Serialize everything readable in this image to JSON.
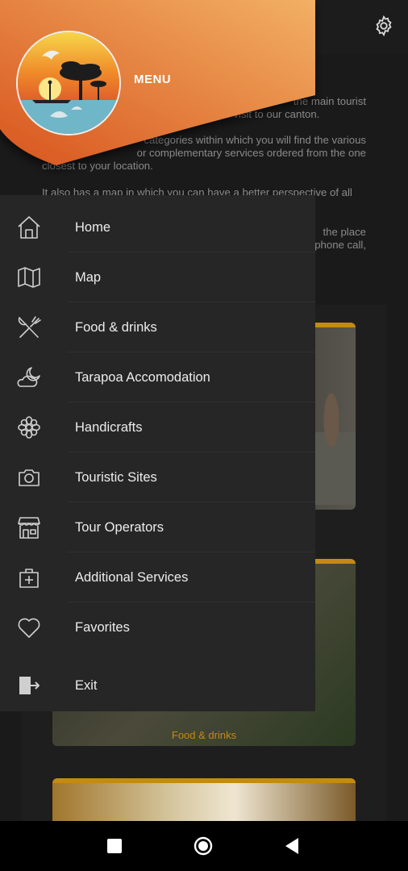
{
  "header": {
    "menu_title": "MENU"
  },
  "background": {
    "paragraphs": [
      "the main tourist",
      "your visit to our canton.",
      "categories within which you will find the various",
      "or complementary services ordered from the one",
      "closest to your location.",
      "It also has a map in which you can have a better perspective of all",
      "the place",
      "phone call,"
    ],
    "card_label": "Food & drinks",
    "accent_color": "#c48a12"
  },
  "drawer": {
    "items": [
      {
        "label": "Home",
        "icon": "home-icon"
      },
      {
        "label": "Map",
        "icon": "map-icon"
      },
      {
        "label": "Food & drinks",
        "icon": "fork-knife-icon"
      },
      {
        "label": "Tarapoa Accomodation",
        "icon": "moon-cloud-icon"
      },
      {
        "label": "Handicrafts",
        "icon": "flower-icon"
      },
      {
        "label": "Touristic Sites",
        "icon": "camera-icon"
      },
      {
        "label": "Tour Operators",
        "icon": "store-icon"
      },
      {
        "label": "Additional Services",
        "icon": "medical-bag-icon"
      },
      {
        "label": "Favorites",
        "icon": "heart-icon"
      },
      {
        "label": "Exit",
        "icon": "exit-icon"
      }
    ]
  },
  "colors": {
    "header_orange_start": "#d8551e",
    "header_orange_end": "#f2b064",
    "drawer_bg": "#262626"
  }
}
